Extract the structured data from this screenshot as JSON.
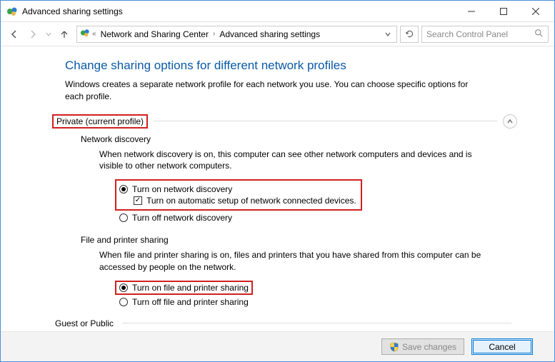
{
  "window": {
    "title": "Advanced sharing settings"
  },
  "nav": {
    "breadcrumb_parent": "Network and Sharing Center",
    "breadcrumb_current": "Advanced sharing settings",
    "search_placeholder": "Search Control Panel"
  },
  "page": {
    "title": "Change sharing options for different network profiles",
    "description": "Windows creates a separate network profile for each network you use. You can choose specific options for each profile."
  },
  "profiles": {
    "private_label": "Private (current profile)",
    "guest_label": "Guest or Public"
  },
  "network_discovery": {
    "title": "Network discovery",
    "description": "When network discovery is on, this computer can see other network computers and devices and is visible to other network computers.",
    "opt_on": "Turn on network discovery",
    "opt_auto": "Turn on automatic setup of network connected devices.",
    "opt_off": "Turn off network discovery"
  },
  "file_printer": {
    "title": "File and printer sharing",
    "description": "When file and printer sharing is on, files and printers that you have shared from this computer can be accessed by people on the network.",
    "opt_on": "Turn on file and printer sharing",
    "opt_off": "Turn off file and printer sharing"
  },
  "buttons": {
    "save": "Save changes",
    "cancel": "Cancel"
  }
}
